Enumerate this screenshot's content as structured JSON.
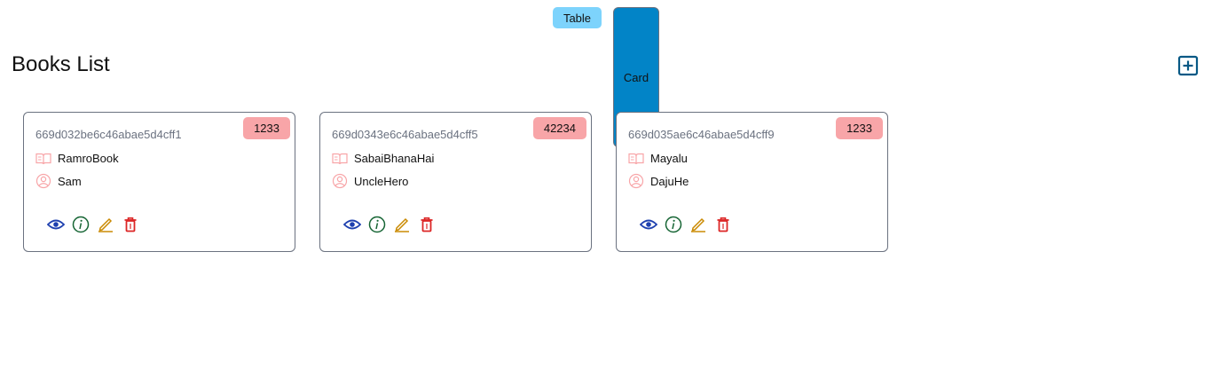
{
  "view_toggle": {
    "table_label": "Table",
    "card_label": "Card",
    "active": "Card"
  },
  "page": {
    "title": "Books List"
  },
  "colors": {
    "accent": "#0284c7",
    "badge": "#f8a5a8",
    "view": "#1e40af",
    "info": "#166534",
    "edit": "#ca8a04",
    "delete": "#dc2626",
    "add": "#075985",
    "meta_icon": "#f8a5a8"
  },
  "books": [
    {
      "id": "669d032be6c46abae5d4cff1",
      "badge": "1233",
      "title": "RamroBook",
      "author": "Sam"
    },
    {
      "id": "669d0343e6c46abae5d4cff5",
      "badge": "42234",
      "title": "SabaiBhanaHai",
      "author": "UncleHero"
    },
    {
      "id": "669d035ae6c46abae5d4cff9",
      "badge": "1233",
      "title": "Mayalu",
      "author": "DajuHe"
    }
  ],
  "icons": {
    "title": "book-open-icon",
    "author": "user-circle-icon",
    "view": "eye-icon",
    "info": "info-icon",
    "edit": "pencil-icon",
    "delete": "trash-icon",
    "add": "plus-square-icon"
  }
}
